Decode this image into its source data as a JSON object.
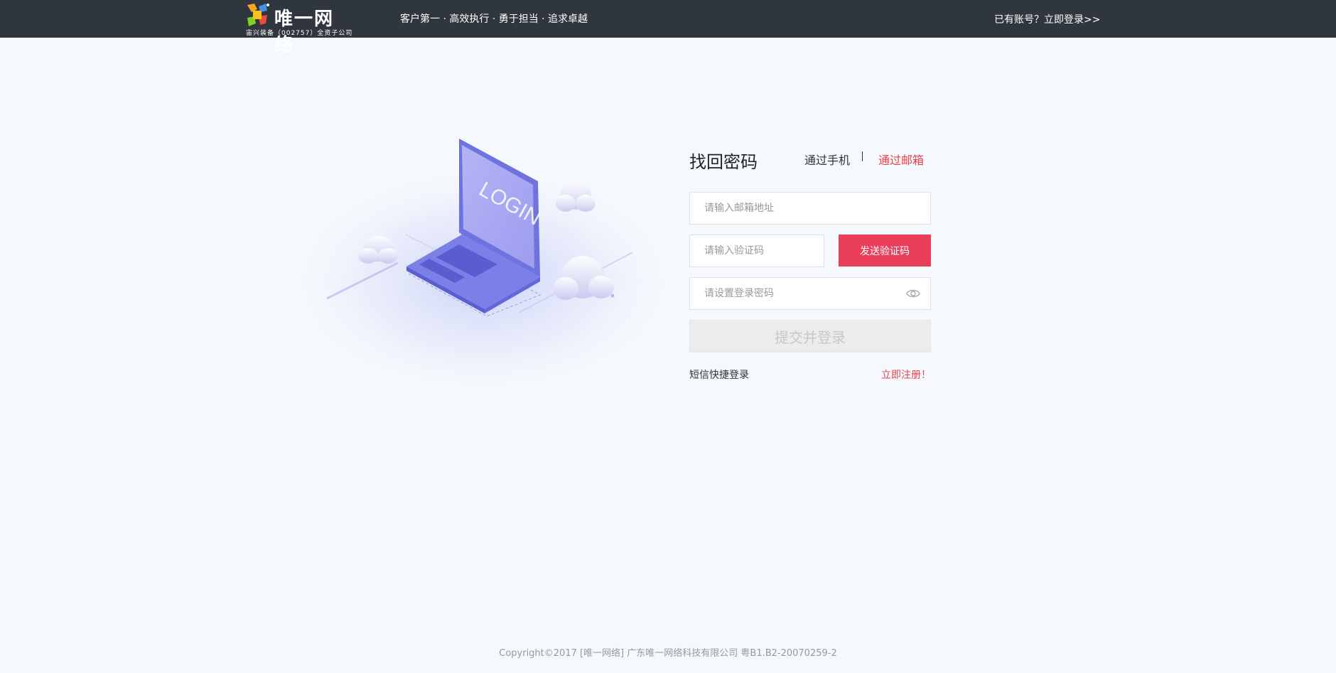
{
  "header": {
    "logo_text": "唯一网络",
    "logo_sub": "宙兴装备（002757）全资子公司",
    "slogan": "客户第一 · 高效执行 · 勇于担当 · 追求卓越",
    "login_link": "已有账号？立即登录>>"
  },
  "illustration": {
    "screen_text": "LOGIN"
  },
  "form": {
    "title": "找回密码",
    "tab_phone": "通过手机",
    "tab_email": "通过邮箱",
    "email_placeholder": "请输入邮箱地址",
    "code_placeholder": "请输入验证码",
    "send_code": "发送验证码",
    "password_placeholder": "请设置登录密码",
    "submit": "提交并登录",
    "sms_login": "短信快捷登录",
    "register": "立即注册！"
  },
  "footer": {
    "copyright": "Copyright©2017 [唯一网络] 广东唯一网络科技有限公司 粤B1.B2-20070259-2"
  },
  "colors": {
    "header_bg": "#2f363d",
    "page_bg": "#f5f8fc",
    "accent_red": "#ea3f5a",
    "laptop_purple": "#7b7fe8"
  }
}
